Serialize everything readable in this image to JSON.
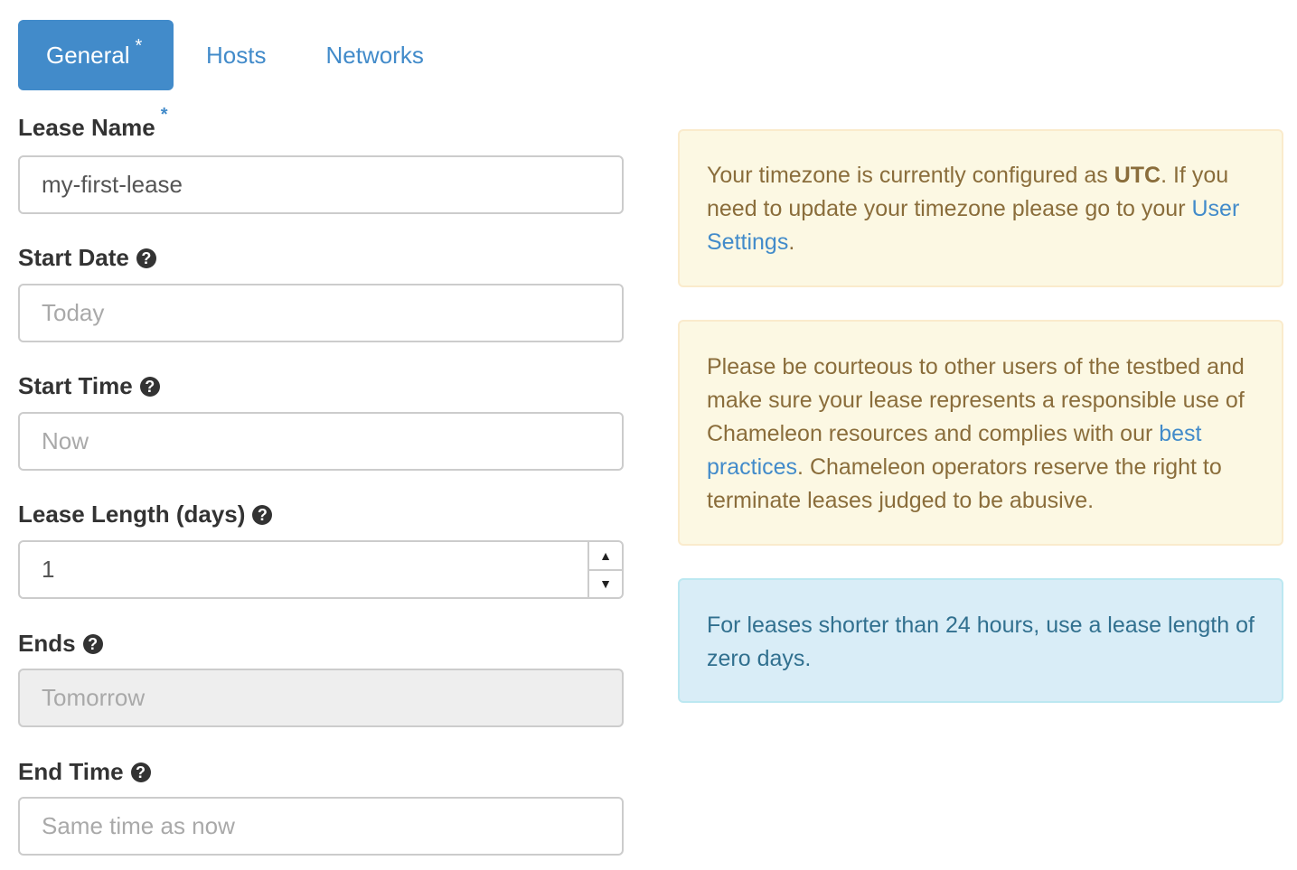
{
  "tabs": [
    {
      "label": "General",
      "marker": "*",
      "active": true
    },
    {
      "label": "Hosts",
      "active": false
    },
    {
      "label": "Networks",
      "active": false
    }
  ],
  "form": {
    "lease_name": {
      "label": "Lease Name",
      "required_marker": "*",
      "value": "my-first-lease"
    },
    "start_date": {
      "label": "Start Date",
      "help_icon": "question-circle-icon",
      "placeholder": "Today"
    },
    "start_time": {
      "label": "Start Time",
      "help_icon": "question-circle-icon",
      "placeholder": "Now"
    },
    "lease_length": {
      "label": "Lease Length (days)",
      "help_icon": "question-circle-icon",
      "value": "1"
    },
    "ends": {
      "label": "Ends",
      "help_icon": "question-circle-icon",
      "placeholder": "Tomorrow",
      "disabled": true
    },
    "end_time": {
      "label": "End Time",
      "help_icon": "question-circle-icon",
      "placeholder": "Same time as now"
    }
  },
  "alerts": {
    "timezone": {
      "text_before": "Your timezone is currently configured as ",
      "timezone": "UTC",
      "text_middle": ". If you need to update your timezone please go to your ",
      "link": "User Settings",
      "text_after": "."
    },
    "courtesy": {
      "text_before": "Please be courteous to other users of the testbed and make sure your lease represents a responsible use of Chameleon resources and complies with our ",
      "link": "best practices",
      "text_after": ". Chameleon operators reserve the right to terminate leases judged to be abusive."
    },
    "info": {
      "text": "For leases shorter than 24 hours, use a lease length of zero days."
    }
  },
  "colors": {
    "primary": "#428bca",
    "warning_bg": "#fcf8e3",
    "warning_text": "#8a6d3b",
    "info_bg": "#d9edf7",
    "info_text": "#31708f"
  }
}
